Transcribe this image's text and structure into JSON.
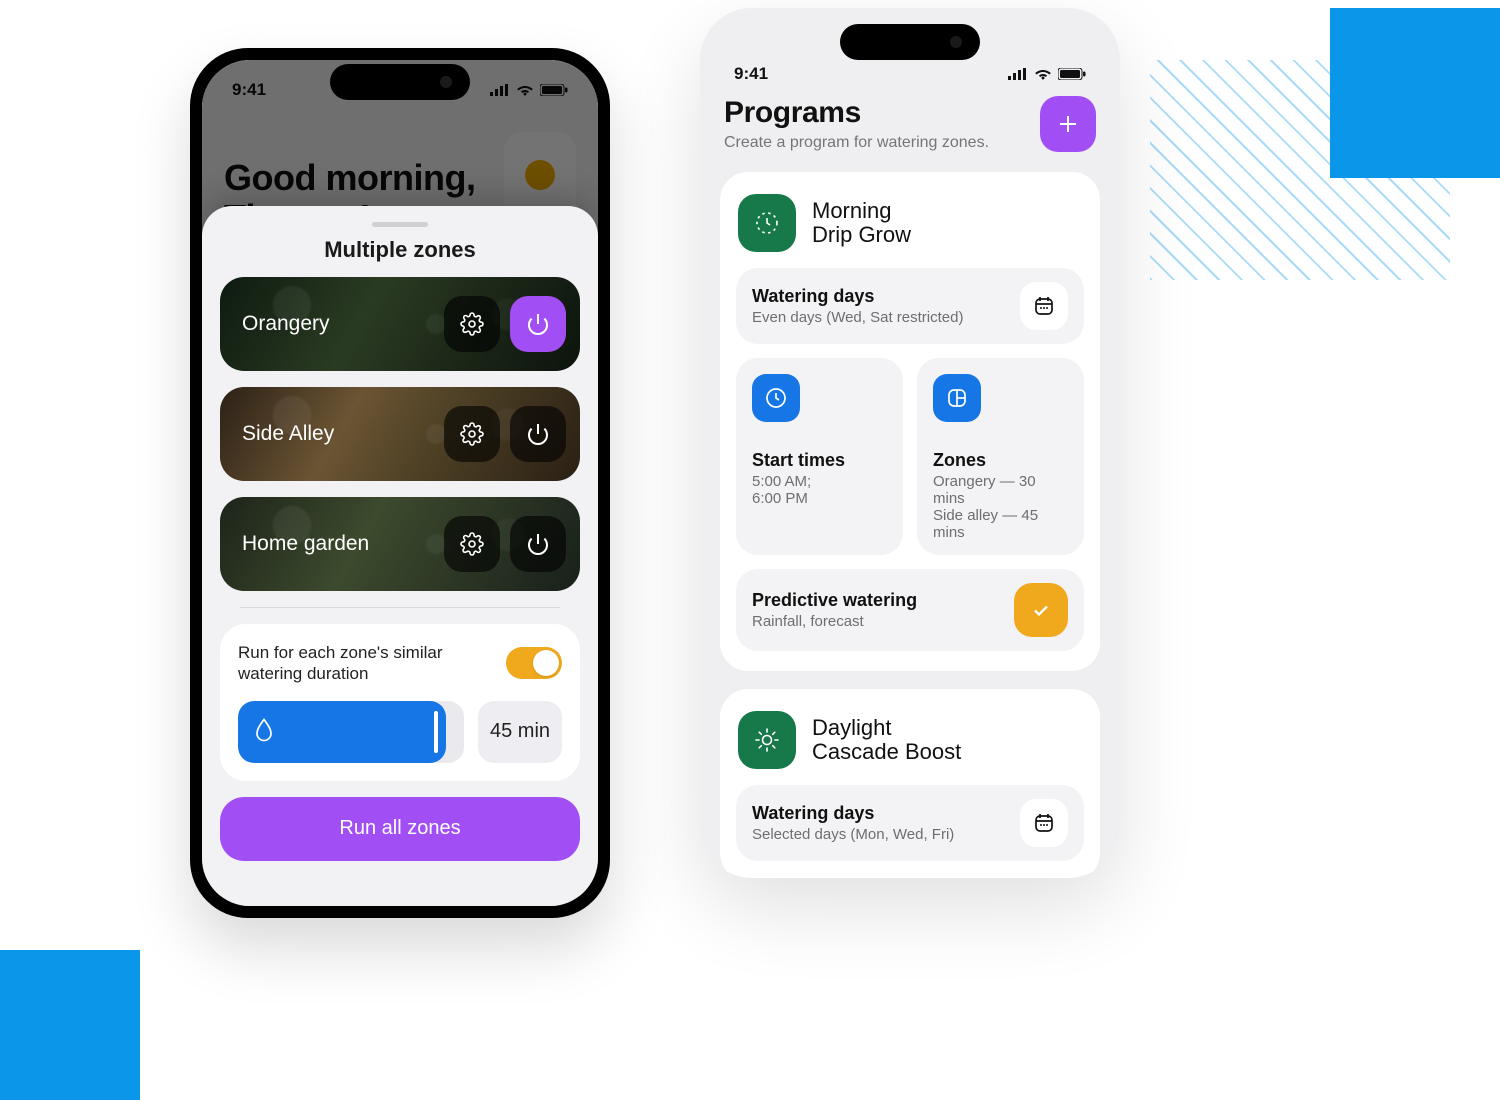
{
  "status_bar": {
    "time": "9:41"
  },
  "left": {
    "greeting_line1": "Good morning,",
    "greeting_line2": "Thomas!",
    "sheet_title": "Multiple zones",
    "zones": [
      {
        "name": "Orangery",
        "power_active": true
      },
      {
        "name": "Side Alley",
        "power_active": false
      },
      {
        "name": "Home garden",
        "power_active": false
      }
    ],
    "toggle_label": "Run for each zone's similar watering duration",
    "toggle_on": true,
    "duration_label": "45 min",
    "run_button": "Run all zones"
  },
  "right": {
    "page_title": "Programs",
    "subtitle": "Create a program for watering zones.",
    "programs": [
      {
        "name_line1": "Morning",
        "name_line2": "Drip Grow",
        "watering_days_title": "Watering days",
        "watering_days_value": "Even days (Wed, Sat restricted)",
        "start_times_title": "Start times",
        "start_times_line1": "5:00 AM;",
        "start_times_line2": "6:00 PM",
        "zones_title": "Zones",
        "zones_line1": "Orangery — 30 mins",
        "zones_line2": "Side alley — 45 mins",
        "predictive_title": "Predictive watering",
        "predictive_value": "Rainfall, forecast",
        "predictive_on": true
      },
      {
        "name_line1": "Daylight",
        "name_line2": "Cascade Boost",
        "watering_days_title": "Watering days",
        "watering_days_value": "Selected days (Mon, Wed, Fri)"
      }
    ]
  },
  "colors": {
    "accent_purple": "#A24EF5",
    "accent_blue": "#1676E6",
    "accent_green": "#17794A",
    "accent_amber": "#F0A81C",
    "brand_blue": "#0A97EA"
  }
}
